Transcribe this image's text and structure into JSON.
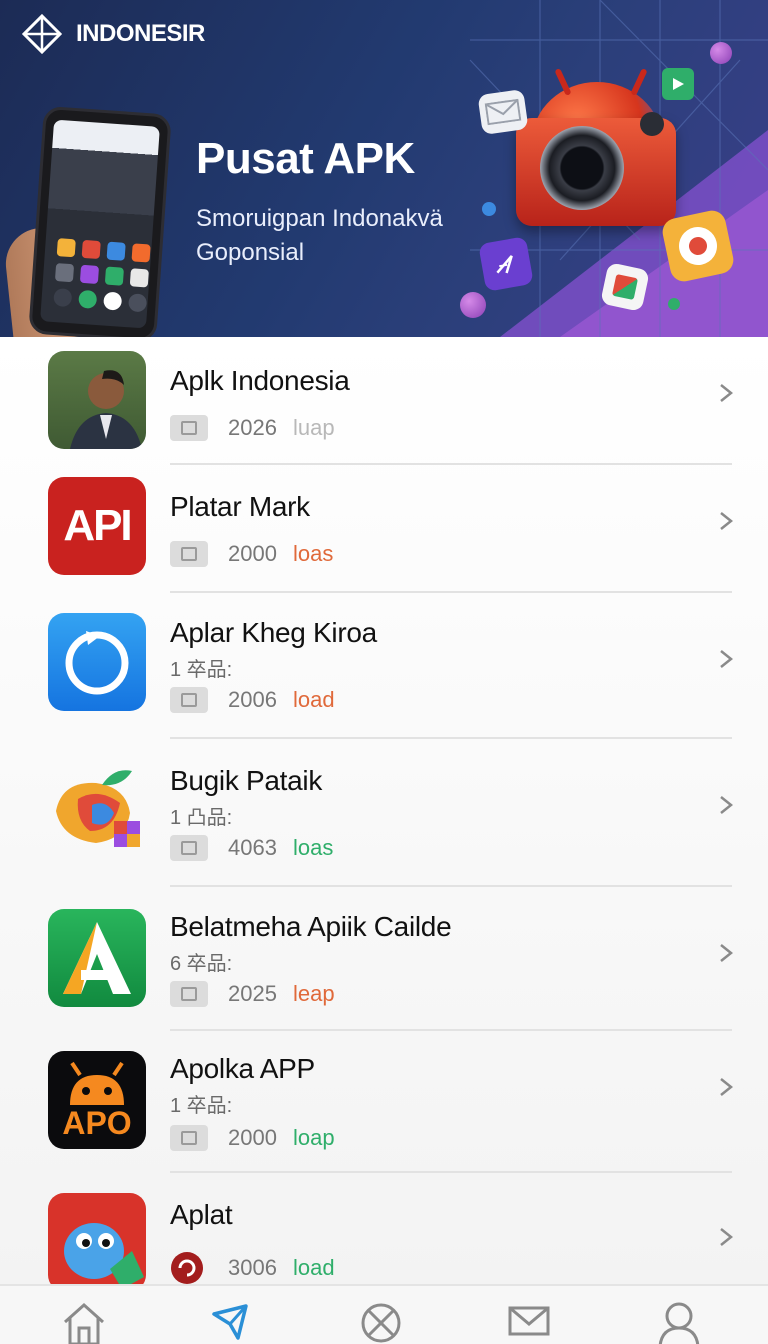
{
  "brand": {
    "name": "INDONESIR",
    "logo_icon": "diamond-compass-icon"
  },
  "banner": {
    "title": "Pusat APK",
    "subtitle": "Smoruigpan Indonakvä Goponsial"
  },
  "apps": [
    {
      "name": "Aplk Indonesia",
      "meta": "",
      "year": "2026",
      "tag": "luap",
      "tag_color": "#b8b8b8",
      "icon": "portrait-photo-icon"
    },
    {
      "name": "Platar Mark",
      "meta": "",
      "year": "2000",
      "tag": "loas",
      "tag_color": "#e0693a",
      "icon": "api-red-icon",
      "icon_text": "API"
    },
    {
      "name": "Aplar Kheg Kiroa",
      "meta": "1 卒品:",
      "year": "2006",
      "tag": "load",
      "tag_color": "#e0693a",
      "icon": "refresh-circle-icon"
    },
    {
      "name": "Bugik Pataik",
      "meta": "1 凸品:",
      "year": "4063",
      "tag": "loas",
      "tag_color": "#2fae6a",
      "icon": "colorful-fruit-icon"
    },
    {
      "name": "Belatmeha Apiik Cailde",
      "meta": "6 卒品:",
      "year": "2025",
      "tag": "leap",
      "tag_color": "#e0693a",
      "icon": "green-a-icon",
      "icon_text": "A"
    },
    {
      "name": "Apolka APP",
      "meta": "1 卒品:",
      "year": "2000",
      "tag": "loap",
      "tag_color": "#2fae6a",
      "icon": "apo-android-icon",
      "icon_text": "APO"
    },
    {
      "name": "Aplat",
      "meta": "",
      "year": "3006",
      "tag": "load",
      "tag_color": "#2fae6a",
      "icon": "blue-creature-icon"
    }
  ],
  "nav": [
    {
      "icon": "home-icon",
      "active": false
    },
    {
      "icon": "navigation-arrow-icon",
      "active": true
    },
    {
      "icon": "close-circle-icon",
      "active": false
    },
    {
      "icon": "mail-icon",
      "active": false
    },
    {
      "icon": "profile-icon",
      "active": false
    }
  ],
  "colors": {
    "accent": "#2a8fd6",
    "nav_icon": "#8a8a8a"
  }
}
